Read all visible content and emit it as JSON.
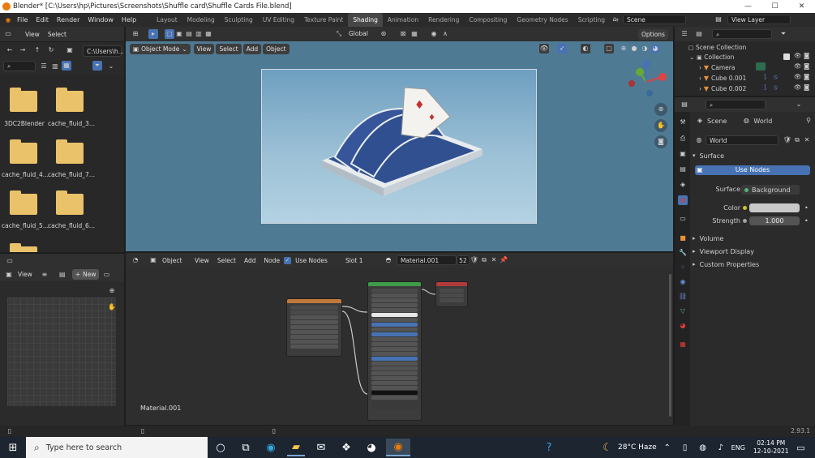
{
  "window": {
    "title": "Blender* [C:\\Users\\hp\\Pictures\\Screenshots\\Shuffle card\\Shuffle Cards File.blend]",
    "minimize": "—",
    "maximize": "☐",
    "close": "✕"
  },
  "topbar": {
    "menus": [
      "File",
      "Edit",
      "Render",
      "Window",
      "Help"
    ],
    "workspaces": [
      "Layout",
      "Modeling",
      "Sculpting",
      "UV Editing",
      "Texture Paint",
      "Shading",
      "Animation",
      "Rendering",
      "Compositing",
      "Geometry Nodes",
      "Scripting"
    ],
    "active_workspace": "Shading",
    "add_tab": "+",
    "scene": "Scene",
    "view_layer": "View Layer"
  },
  "file_browser": {
    "header_menus": [
      "View",
      "Select"
    ],
    "path": "C:\\Users\\h...",
    "items": [
      "3DC2Blender",
      "cache_fluid_3...",
      "cache_fluid_4...",
      "cache_fluid_7...",
      "cache_fluid_5...",
      "cache_fluid_6..."
    ]
  },
  "image_editor": {
    "view_label": "View",
    "new_label": "New"
  },
  "viewport": {
    "mode": "Object Mode",
    "menus": [
      "View",
      "Select",
      "Add",
      "Object"
    ],
    "transform": "Global",
    "options": "Options"
  },
  "node_editor": {
    "type": "Object",
    "menus": [
      "View",
      "Select",
      "Add",
      "Node"
    ],
    "use_nodes_label": "Use Nodes",
    "slot": "Slot 1",
    "material": "Material.001",
    "users": "52",
    "material_label": "Material.001"
  },
  "outliner": {
    "root": "Scene Collection",
    "collection": "Collection",
    "items": [
      "Camera",
      "Cube 0.001",
      "Cube 0.002"
    ]
  },
  "properties": {
    "scene_tab": "Scene",
    "world_tab": "World",
    "world_name": "World",
    "surface_section": "Surface",
    "use_nodes_button": "Use Nodes",
    "surface_label": "Surface",
    "surface_value": "Background",
    "color_label": "Color",
    "strength_label": "Strength",
    "strength_value": "1.000",
    "collapsed_sections": [
      "Volume",
      "Viewport Display",
      "Custom Properties"
    ]
  },
  "status": {
    "version": "2.93.1"
  },
  "taskbar": {
    "search_placeholder": "Type here to search",
    "weather": "28°C Haze",
    "language": "ENG",
    "time": "02:14 PM",
    "date": "12-10-2021"
  },
  "colors": {
    "accent": "#4772b3",
    "viewport_bg": "#a9c5d6",
    "title_bg": "#ffffff",
    "taskbar_bg": "#1c2530"
  }
}
